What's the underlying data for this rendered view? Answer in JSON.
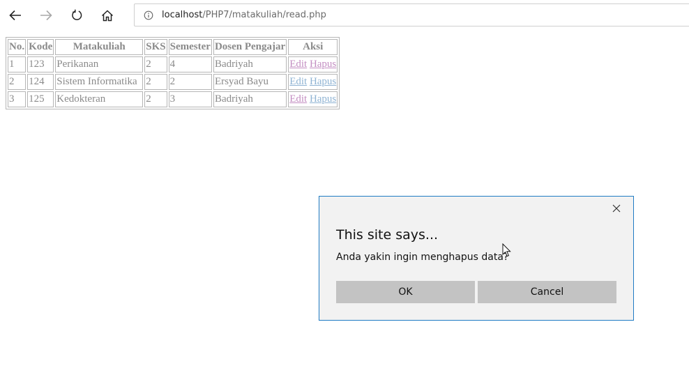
{
  "browser": {
    "url_host": "localhost",
    "url_path": "/PHP7/matakuliah/read.php"
  },
  "table": {
    "headers": [
      "No.",
      "Kode",
      "Matakuliah",
      "SKS",
      "Semester",
      "Dosen Pengajar",
      "Aksi"
    ],
    "rows": [
      {
        "no": "1",
        "kode": "123",
        "matakuliah": "Perikanan",
        "sks": "2",
        "semester": "4",
        "dosen": "Badriyah",
        "edit": "Edit",
        "hapus": "Hapus"
      },
      {
        "no": "2",
        "kode": "124",
        "matakuliah": "Sistem Informatika",
        "sks": "2",
        "semester": "2",
        "dosen": "Ersyad Bayu",
        "edit": "Edit",
        "hapus": "Hapus"
      },
      {
        "no": "3",
        "kode": "125",
        "matakuliah": "Kedokteran",
        "sks": "2",
        "semester": "3",
        "dosen": "Badriyah",
        "edit": "Edit",
        "hapus": "Hapus"
      }
    ]
  },
  "dialog": {
    "title": "This site says...",
    "message": "Anda yakin ingin menghapus data?",
    "ok_label": "OK",
    "cancel_label": "Cancel"
  },
  "colors": {
    "visited_link": "#c38ec2",
    "unvisited_link": "#8fb3d3",
    "dialog_border": "#1f7bc4",
    "dialog_button": "#c3c3c3"
  }
}
